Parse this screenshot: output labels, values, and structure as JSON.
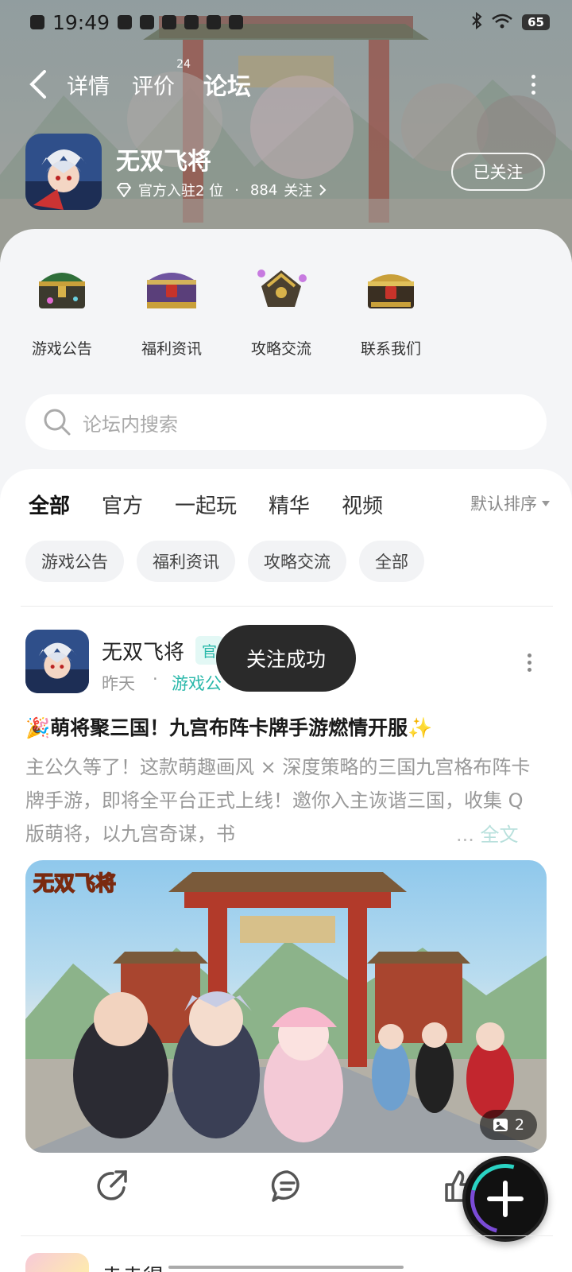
{
  "status_bar": {
    "time": "19:49",
    "battery": "65"
  },
  "nav": {
    "tabs": [
      {
        "label": "详情"
      },
      {
        "label": "评价",
        "badge": "24"
      },
      {
        "label": "论坛",
        "active": true
      }
    ]
  },
  "app": {
    "name": "无双飞将",
    "official": "官方入驻2 位",
    "separator": "·",
    "followers": "884",
    "followers_label": "关注",
    "follow_button": "已关注"
  },
  "shortcuts": [
    {
      "label": "游戏公告",
      "icon": "treasure-chest-green-icon"
    },
    {
      "label": "福利资讯",
      "icon": "treasure-chest-purple-icon"
    },
    {
      "label": "攻略交流",
      "icon": "treasure-chest-open-icon"
    },
    {
      "label": "联系我们",
      "icon": "treasure-chest-gold-icon"
    }
  ],
  "search": {
    "placeholder": "论坛内搜索"
  },
  "filter_tabs": [
    {
      "label": "全部",
      "active": true
    },
    {
      "label": "官方"
    },
    {
      "label": "一起玩"
    },
    {
      "label": "精华"
    },
    {
      "label": "视频"
    }
  ],
  "sort_label": "默认排序",
  "chips": [
    "游戏公告",
    "福利资讯",
    "攻略交流",
    "全部"
  ],
  "post": {
    "author": "无双飞将",
    "badge": "官",
    "time": "昨天",
    "dot": "·",
    "board": "游戏公",
    "title": "🎉萌将聚三国！九宫布阵卡牌手游燃情开服✨",
    "body": "主公久等了！这款萌趣画风 × 深度策略的三国九宫格布阵卡牌手游，即将全平台正式上线！邀你入主诙谐三国，收集 Q 版萌将，以九宫奇谋，书",
    "ellipsis": "...",
    "read_more": "全文",
    "image_logo": "无双飞将",
    "image_count": "2"
  },
  "toast": "关注成功",
  "next_post": {
    "author": "幸幸得"
  },
  "colors": {
    "accent": "#2ad3c3",
    "teal_text": "#2ab8aa"
  }
}
